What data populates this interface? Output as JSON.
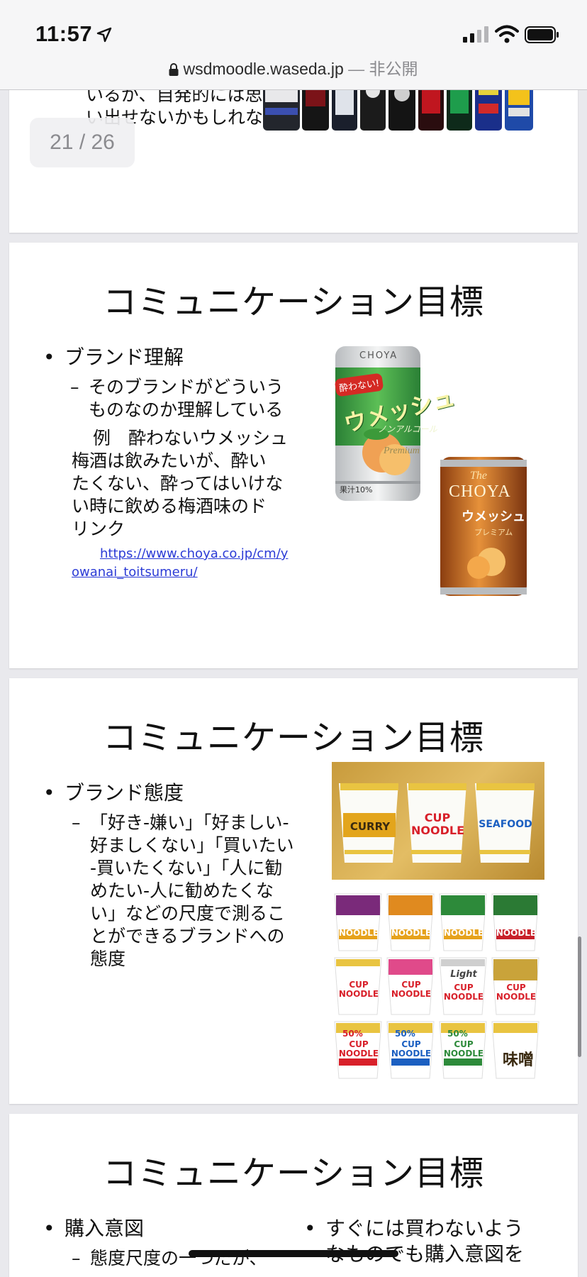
{
  "status_bar": {
    "time": "11:57"
  },
  "browser": {
    "domain": "wsdmoodle.waseda.jp",
    "privacy": " — 非公開"
  },
  "viewer": {
    "page_counter": "21 / 26"
  },
  "slide_top": {
    "text_line1": "いるが、自発的には思",
    "text_line2": "い出せないかもしれな"
  },
  "slide_understanding": {
    "title": "コミュニケーション目標",
    "bullet": "ブランド理解",
    "sub_dash": "–",
    "sub_line1": "そのブランドがどういう",
    "sub_line2": "ものなのか理解している",
    "example_line1": "例　酔わないウメッシュ",
    "example_line2": "梅酒は飲みたいが、酔い",
    "example_line3": "たくない、酔ってはいけな",
    "example_line4": "い時に飲める梅酒味のド",
    "example_line5": "リンク",
    "link_line1": "https://www.choya.co.jp/cm/y",
    "link_line2": "owanai_toitsumeru/",
    "can1_brand": "CHOYA",
    "can1_badge": "酔わない!",
    "can1_name": "ウメッシュ",
    "can1_sub": "ノンアルコール",
    "can1_premium": "Premium",
    "can1_juice": "果汁10%",
    "can2_the": "The",
    "can2_brand": "CHOYA",
    "can2_name": "ウメッシュ",
    "can2_sub": "プレミアム"
  },
  "slide_attitude": {
    "title": "コミュニケーション目標",
    "bullet": "ブランド態度",
    "sub_dash": "–",
    "sub_line1": "「好き-嫌い」「好ましい-",
    "sub_line2": "好ましくない」「買いたい",
    "sub_line3": "-買いたくない」「人に勧",
    "sub_line4": "めたい-人に勧めたくな",
    "sub_line5": "い」などの尺度で測るこ",
    "sub_line6": "とができるブランドへの",
    "sub_line7": "態度",
    "cup1_label": "CURRY",
    "cup2_label": "CUP NOODLE",
    "cup3_label": "SEAFOOD",
    "grid_cup_label": "CUP NOODLE",
    "grid_light": "Light",
    "grid_miso": "味噌",
    "grid_50": "50%"
  },
  "slide_bottom": {
    "title": "コミュニケーション目標",
    "bullet_left": "購入意図",
    "sub_left": "態度尺度の一つだが、",
    "bullet_right_line1": "すぐには買わないよう",
    "bullet_right_line2": "なものでも購入意図を"
  },
  "colors": {
    "link": "#2b3bd6",
    "umeshu_green": "#2f9a3e",
    "umeshu_gold": "#c8741a",
    "cup_red": "#d8202a"
  }
}
